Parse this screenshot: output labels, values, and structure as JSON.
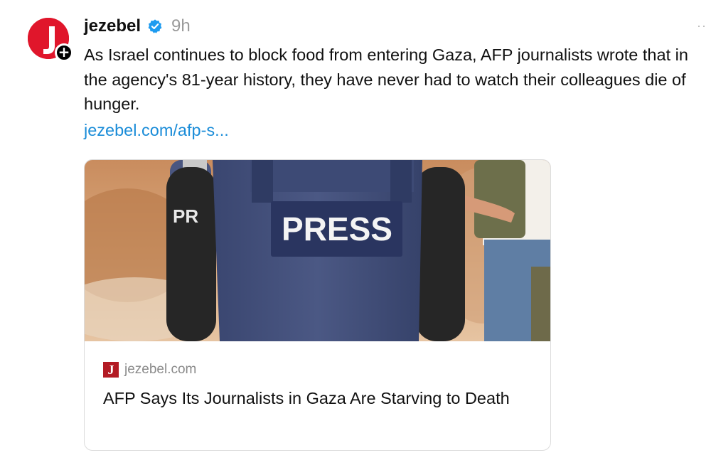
{
  "author": {
    "username": "jezebel",
    "verified": true,
    "timestamp": "9h",
    "avatar_color": "#e0162b"
  },
  "post": {
    "text": "As Israel continues to block food from entering Gaza, AFP journalists wrote that in the agency's 81-year history, they have never had to watch their colleagues die of hunger.",
    "link": "jezebel.com/afp-s..."
  },
  "card": {
    "image_text": "PRESS",
    "image_text_partial": "PR",
    "source_domain": "jezebel.com",
    "favicon_letter": "J",
    "title": "AFP Says Its Journalists in Gaza Are Starving to Death"
  },
  "icons": {
    "follow": "+",
    "more": "··"
  },
  "colors": {
    "link": "#1a8cd8",
    "verified": "#1d9bf0",
    "favicon": "#b31b24"
  }
}
